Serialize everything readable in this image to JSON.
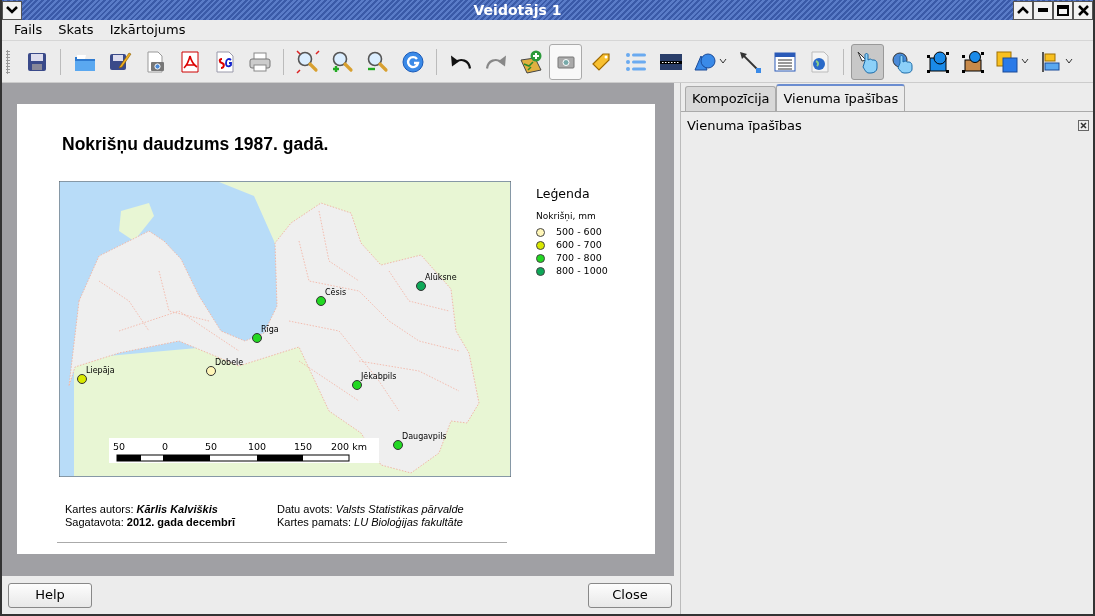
{
  "window": {
    "title": "Veidotājs 1"
  },
  "menu": [
    "Fails",
    "Skats",
    "Izkārtojums"
  ],
  "toolbar": [
    {
      "kind": "button",
      "pressed": false,
      "hovered": false,
      "menu": false
    },
    {
      "kind": "separator"
    },
    {
      "kind": "button",
      "pressed": false,
      "hovered": false,
      "menu": false
    },
    {
      "kind": "button",
      "pressed": false,
      "hovered": false,
      "menu": false
    },
    {
      "kind": "button",
      "pressed": false,
      "hovered": false,
      "menu": false
    },
    {
      "kind": "button",
      "pressed": false,
      "hovered": false,
      "menu": false
    },
    {
      "kind": "button",
      "pressed": false,
      "hovered": false,
      "menu": false
    },
    {
      "kind": "button",
      "pressed": false,
      "hovered": false,
      "menu": false
    },
    {
      "kind": "separator"
    },
    {
      "kind": "button",
      "pressed": false,
      "hovered": false,
      "menu": false
    },
    {
      "kind": "button",
      "pressed": false,
      "hovered": false,
      "menu": false
    },
    {
      "kind": "button",
      "pressed": false,
      "hovered": false,
      "menu": false
    },
    {
      "kind": "button",
      "pressed": false,
      "hovered": false,
      "menu": false
    },
    {
      "kind": "separator"
    },
    {
      "kind": "button",
      "pressed": false,
      "hovered": false,
      "menu": false
    },
    {
      "kind": "button",
      "pressed": false,
      "hovered": false,
      "menu": false
    },
    {
      "kind": "button",
      "pressed": false,
      "hovered": false,
      "menu": false
    },
    {
      "kind": "button",
      "pressed": false,
      "hovered": true,
      "menu": false
    },
    {
      "kind": "button",
      "pressed": false,
      "hovered": false,
      "menu": false
    },
    {
      "kind": "button",
      "pressed": false,
      "hovered": false,
      "menu": false
    },
    {
      "kind": "button",
      "pressed": false,
      "hovered": false,
      "menu": false
    },
    {
      "kind": "button",
      "pressed": false,
      "hovered": false,
      "menu": true
    },
    {
      "kind": "button",
      "pressed": false,
      "hovered": false,
      "menu": false
    },
    {
      "kind": "button",
      "pressed": false,
      "hovered": false,
      "menu": false
    },
    {
      "kind": "button",
      "pressed": false,
      "hovered": false,
      "menu": false
    },
    {
      "kind": "separator"
    },
    {
      "kind": "button",
      "pressed": true,
      "hovered": false,
      "menu": false
    },
    {
      "kind": "button",
      "pressed": false,
      "hovered": false,
      "menu": false
    },
    {
      "kind": "button",
      "pressed": false,
      "hovered": false,
      "menu": false
    },
    {
      "kind": "button",
      "pressed": false,
      "hovered": false,
      "menu": false
    },
    {
      "kind": "button",
      "pressed": false,
      "hovered": false,
      "menu": true
    },
    {
      "kind": "button",
      "pressed": false,
      "hovered": false,
      "menu": true
    }
  ],
  "composition": {
    "title": "Nokrišņu daudzums 1987. gadā.",
    "cities": [
      {
        "name": "Liepāja",
        "color": "#d8e800"
      },
      {
        "name": "Dobele",
        "color": "#fff6b8"
      },
      {
        "name": "Rīga",
        "color": "#22d822"
      },
      {
        "name": "Cēsis",
        "color": "#22d822"
      },
      {
        "name": "Alūksne",
        "color": "#0ea858"
      },
      {
        "name": "Jēkabpils",
        "color": "#22d822"
      },
      {
        "name": "Daugavpils",
        "color": "#22d822"
      }
    ],
    "scale_labels": [
      "50",
      "0",
      "50",
      "100",
      "150",
      "200 km"
    ],
    "legend": {
      "title": "Leģenda",
      "subtitle": "Nokrišņi, mm",
      "items": [
        {
          "label": "500 - 600",
          "color": "#fff6b8"
        },
        {
          "label": "600 - 700",
          "color": "#d8e800"
        },
        {
          "label": "700 - 800",
          "color": "#22d822"
        },
        {
          "label": "800 - 1000",
          "color": "#0ea858"
        }
      ]
    },
    "footer": [
      {
        "label": "Kartes autors:",
        "value": "Kārlis Kalviškis"
      },
      {
        "label": "Datu avots:",
        "value": "Valsts Statistikas pārvalde"
      },
      {
        "label": "Sagatavota:",
        "value": "2012. gada decembrī"
      },
      {
        "label": "Kartes pamats:",
        "value": "LU Bioloģijas fakultāte"
      }
    ]
  },
  "tabs": [
    {
      "label": "Kompozīcija",
      "selected": false
    },
    {
      "label": "Vienuma īpašības",
      "selected": true
    }
  ],
  "panel": {
    "title": "Vienuma īpašības"
  },
  "buttons": [
    "Help",
    "Close"
  ]
}
